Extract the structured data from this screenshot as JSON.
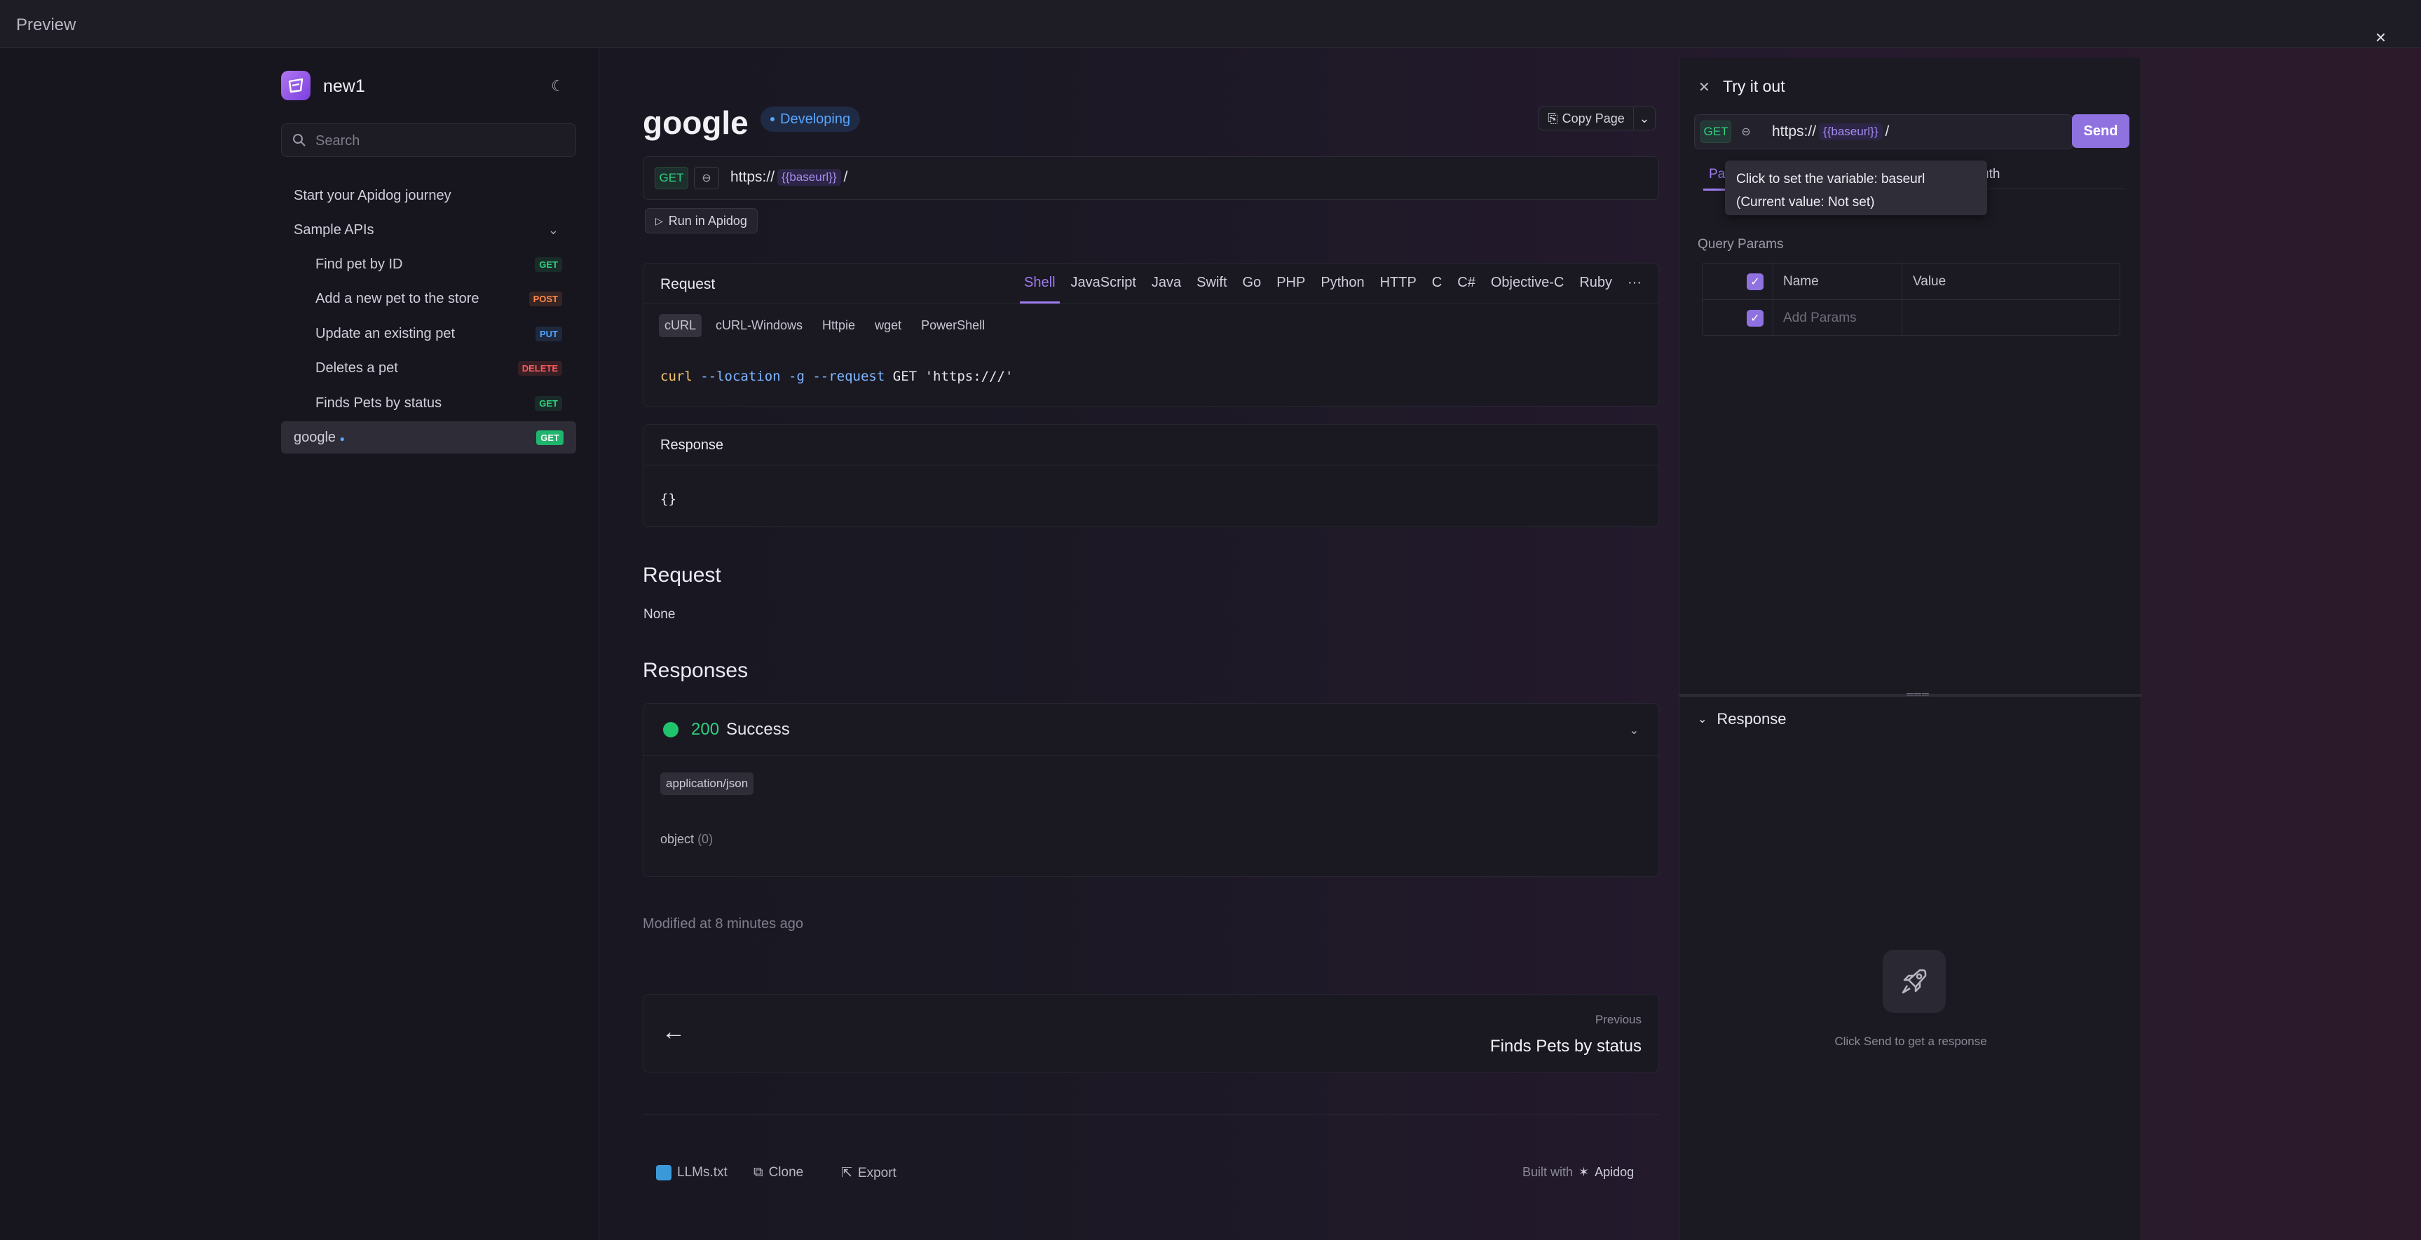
{
  "window": {
    "title": "Preview",
    "close": "×"
  },
  "sidebar": {
    "project": "new1",
    "search_placeholder": "Search",
    "items": [
      {
        "label": "Start your Apidog journey"
      },
      {
        "label": "Sample APIs",
        "chevron": "⌄"
      },
      {
        "label": "Find pet by ID",
        "method": "GET"
      },
      {
        "label": "Add a new pet to the store",
        "method": "POST"
      },
      {
        "label": "Update an existing pet",
        "method": "PUT"
      },
      {
        "label": "Deletes a pet",
        "method": "DELETE"
      },
      {
        "label": "Finds Pets by status",
        "method": "GET"
      },
      {
        "label": "google",
        "method": "GET",
        "active": true
      }
    ]
  },
  "main": {
    "title": "google",
    "status": "Developing",
    "copy_page": "Copy Page",
    "method": "GET",
    "url_prefix": "https://",
    "url_var": "{{baseurl}}",
    "url_suffix": "/",
    "run_button": "Run in Apidog",
    "request_panel": {
      "title": "Request",
      "languages": [
        "Shell",
        "JavaScript",
        "Java",
        "Swift",
        "Go",
        "PHP",
        "Python",
        "HTTP",
        "C",
        "C#",
        "Objective-C",
        "Ruby",
        "···"
      ],
      "active_language": "Shell",
      "sub_tabs": [
        "cURL",
        "cURL-Windows",
        "Httpie",
        "wget",
        "PowerShell"
      ],
      "code": {
        "cmd": "curl",
        "opts": "--location -g --request",
        "method": "GET",
        "url": "'https:///'"
      }
    },
    "response_panel": {
      "title": "Response",
      "body": "{}"
    },
    "request_section": {
      "title": "Request",
      "body": "None"
    },
    "responses_section": {
      "title": "Responses",
      "code": "200",
      "status_text": "Success",
      "content_type": "application/json",
      "schema": "object",
      "schema_count": "(0)"
    },
    "modified": "Modified at 8 minutes ago",
    "previous": {
      "label": "Previous",
      "name": "Finds Pets by status"
    },
    "footer": {
      "links": [
        "LLMs.txt",
        "Clone",
        "Export"
      ],
      "built_with": "Built with",
      "brand": "Apidog"
    }
  },
  "try_it": {
    "title": "Try it out",
    "method": "GET",
    "url_prefix": "https://",
    "url_var": "{{baseurl}}",
    "url_suffix": "/",
    "send": "Send",
    "tab_params": "Pa",
    "tab_auth": "uth",
    "tooltip_line1": "Click to set the variable: baseurl",
    "tooltip_line2": "(Current value: Not set)",
    "query_params_label": "Query Params",
    "col_name": "Name",
    "col_value": "Value",
    "add_params_placeholder": "Add Params",
    "response_title": "Response",
    "empty_hint": "Click Send to get a response"
  },
  "colors": {
    "accent": "#8f72e0",
    "get": "#2fd07f",
    "post": "#ff8a4c",
    "put": "#4ea3ff",
    "delete": "#ff5a5a"
  }
}
